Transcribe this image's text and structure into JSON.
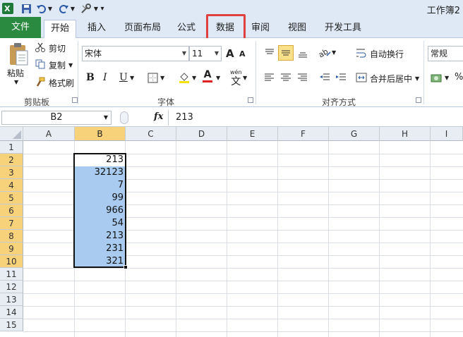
{
  "window": {
    "title": "工作簿2",
    "quick_access": {
      "more_label": "▾"
    }
  },
  "ribbon_tabs": [
    {
      "id": "file",
      "label": "文件"
    },
    {
      "id": "home",
      "label": "开始"
    },
    {
      "id": "insert",
      "label": "插入"
    },
    {
      "id": "page_layout",
      "label": "页面布局"
    },
    {
      "id": "formulas",
      "label": "公式"
    },
    {
      "id": "data",
      "label": "数据"
    },
    {
      "id": "review",
      "label": "审阅"
    },
    {
      "id": "view",
      "label": "视图"
    },
    {
      "id": "developer",
      "label": "开发工具"
    }
  ],
  "active_tab": "home",
  "highlighted_tab": "data",
  "clipboard": {
    "group_label": "剪贴板",
    "paste_label": "粘贴",
    "cut_label": "剪切",
    "copy_label": "复制",
    "format_painter_label": "格式刷"
  },
  "font": {
    "group_label": "字体",
    "font_name": "宋体",
    "font_size": "11",
    "bold_label": "B",
    "italic_label": "I",
    "underline_label": "U",
    "grow_label": "A",
    "shrink_label": "A",
    "font_color_label": "A",
    "phonetic_label": "文"
  },
  "alignment": {
    "group_label": "对齐方式",
    "wrap_text_label": "自动换行",
    "merge_center_label": "合并后居中"
  },
  "number": {
    "format_value": "常规",
    "percent_label": "%"
  },
  "formula_bar": {
    "name_box": "B2",
    "fx_label": "fx",
    "formula": "213"
  },
  "sheet": {
    "columns": [
      "A",
      "B",
      "C",
      "D",
      "E",
      "F",
      "G",
      "H",
      "I"
    ],
    "rows": [
      "1",
      "2",
      "3",
      "4",
      "5",
      "6",
      "7",
      "8",
      "9",
      "10",
      "11",
      "12",
      "13",
      "14",
      "15"
    ],
    "selected_column": "B",
    "selected_rows": [
      "2",
      "3",
      "4",
      "5",
      "6",
      "7",
      "8",
      "9",
      "10"
    ],
    "column_b_values": [
      "",
      "213",
      "32123",
      "7",
      "99",
      "966",
      "54",
      "213",
      "231",
      "321"
    ]
  },
  "colors": {
    "file_tab": "#2a8a3f",
    "selection_fill": "#a8cbef",
    "header_selected": "#f7d27a",
    "highlight_border": "#e04040"
  }
}
